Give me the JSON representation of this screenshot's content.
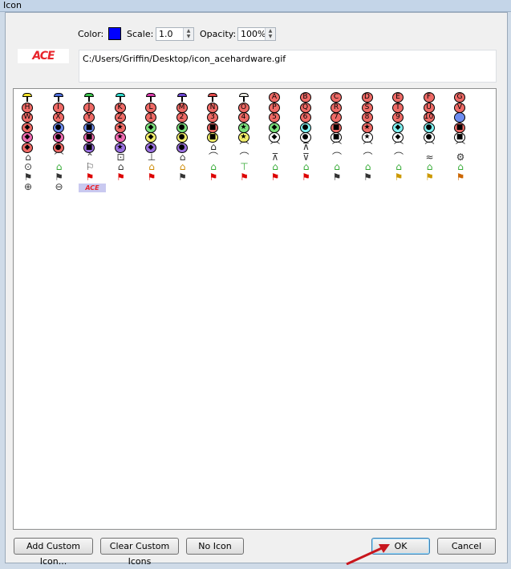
{
  "window": {
    "title": "Icon"
  },
  "controls": {
    "color_label": "Color:",
    "color_value": "#0000ff",
    "scale_label": "Scale:",
    "scale_value": "1.0",
    "opacity_label": "Opacity:",
    "opacity_value": "100%"
  },
  "preview": {
    "logo_text": "ACE",
    "path": "C:/Users/Griffin/Desktop/icon_acehardware.gif"
  },
  "icon_grid": {
    "pin_colors": [
      "#f2e22a",
      "#4a6bd8",
      "#39c24a",
      "#2fd6c8",
      "#d63aa8",
      "#6a45d0",
      "#e04a4a",
      "#e8e8e0"
    ],
    "letter_row1": [
      "H",
      "I",
      "J",
      "K",
      "L",
      "M",
      "N",
      "O",
      "P",
      "Q",
      "R",
      "S",
      "T",
      "U",
      "V"
    ],
    "letter_row0": [
      "A",
      "B",
      "C",
      "D",
      "E",
      "F",
      "G"
    ],
    "letter_row2": [
      "W",
      "X",
      "Y",
      "Z",
      "1",
      "2",
      "3",
      "4",
      "5",
      "6",
      "7",
      "8",
      "9",
      "10"
    ],
    "custom_logo_text": "ACE"
  },
  "buttons": {
    "add_custom": "Add Custom Icon...",
    "clear_custom": "Clear Custom Icons",
    "no_icon": "No Icon",
    "ok": "OK",
    "cancel": "Cancel"
  }
}
